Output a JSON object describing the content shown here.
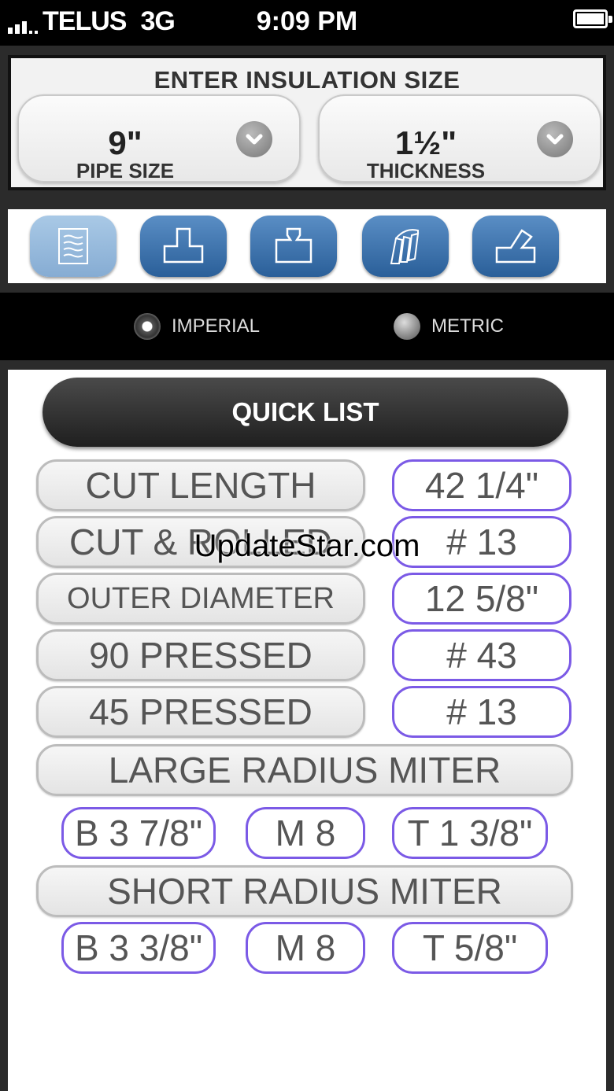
{
  "status_bar": {
    "carrier": "TELUS",
    "network": "3G",
    "time": "9:09 PM"
  },
  "insulation": {
    "title": "ENTER INSULATION SIZE",
    "pipe": {
      "value": "9\"",
      "label": "PIPE SIZE"
    },
    "thickness": {
      "value": "1½\"",
      "label": "THICKNESS"
    }
  },
  "toolbar": {
    "icons": [
      "list-icon",
      "tee-fitting-icon",
      "reducing-tee-icon",
      "elbow-segments-icon",
      "angled-cut-icon"
    ],
    "active_index": 0
  },
  "units": {
    "imperial": "IMPERIAL",
    "metric": "METRIC",
    "selected": "imperial"
  },
  "quick_list": {
    "title": "QUICK LIST",
    "rows": [
      {
        "label": "CUT LENGTH",
        "value": "42 1/4\""
      },
      {
        "label": "CUT & ROLLED",
        "value": "# 13"
      },
      {
        "label": "OUTER DIAMETER",
        "value": "12 5/8\""
      },
      {
        "label": "90 PRESSED",
        "value": "# 43"
      },
      {
        "label": "45 PRESSED",
        "value": "# 13"
      }
    ],
    "large_miter": {
      "title": "LARGE RADIUS MITER",
      "b": "B 3 7/8\"",
      "m": "M 8",
      "t": "T 1 3/8\""
    },
    "short_miter": {
      "title": "SHORT RADIUS MITER",
      "b": "B 3 3/8\"",
      "m": "M 8",
      "t": "T 5/8\""
    }
  },
  "watermark": "UpdateStar.com",
  "colors": {
    "tool_blue": "#2a5f99",
    "value_border": "#7b5ae6"
  }
}
